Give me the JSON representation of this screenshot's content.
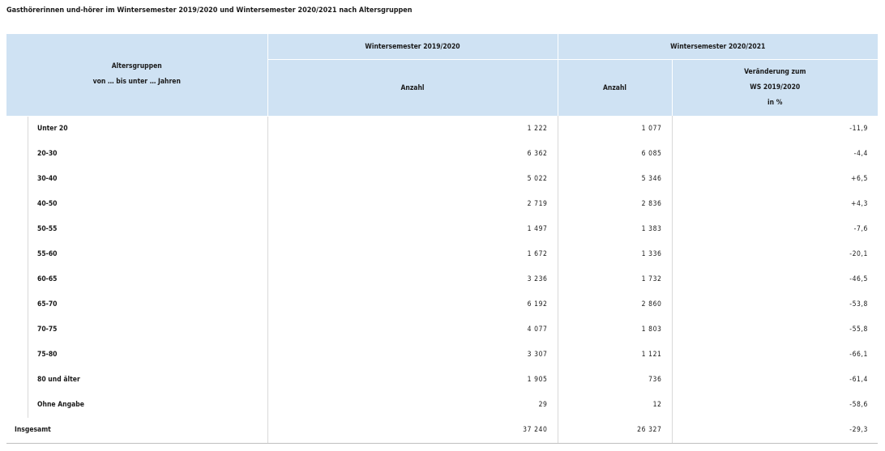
{
  "title": "Gasthörerinnen und-hörer im Wintersemester 2019/2020 und Wintersemester 2020/2021 nach Altersgruppen",
  "header": {
    "group_label_line1": "Altersgruppen",
    "group_label_line2": "von … bis unter … Jahren",
    "ws1": "Wintersemester 2019/2020",
    "ws2": "Wintersemester 2020/2021",
    "anzahl1": "Anzahl",
    "anzahl2": "Anzahl",
    "change_line1": "Veränderung zum",
    "change_line2": "WS 2019/2020",
    "change_line3": "in %"
  },
  "rows": [
    {
      "label": "Unter 20",
      "ws1": "1 222",
      "ws2": "1 077",
      "change": "-11,9"
    },
    {
      "label": "20-30",
      "ws1": "6 362",
      "ws2": "6 085",
      "change": "-4,4"
    },
    {
      "label": "30-40",
      "ws1": "5 022",
      "ws2": "5 346",
      "change": "+6,5"
    },
    {
      "label": "40-50",
      "ws1": "2 719",
      "ws2": "2 836",
      "change": "+4,3"
    },
    {
      "label": "50-55",
      "ws1": "1 497",
      "ws2": "1 383",
      "change": "-7,6"
    },
    {
      "label": "55-60",
      "ws1": "1 672",
      "ws2": "1 336",
      "change": "-20,1"
    },
    {
      "label": "60-65",
      "ws1": "3 236",
      "ws2": "1 732",
      "change": "-46,5"
    },
    {
      "label": "65-70",
      "ws1": "6 192",
      "ws2": "2 860",
      "change": "-53,8"
    },
    {
      "label": "70-75",
      "ws1": "4 077",
      "ws2": "1 803",
      "change": "-55,8"
    },
    {
      "label": "75-80",
      "ws1": "3 307",
      "ws2": "1 121",
      "change": "-66,1"
    },
    {
      "label": "80 und älter",
      "ws1": "1 905",
      "ws2": "736",
      "change": "-61,4"
    },
    {
      "label": "Ohne Angabe",
      "ws1": "29",
      "ws2": "12",
      "change": "-58,6"
    }
  ],
  "total": {
    "label": "Insgesamt",
    "ws1": "37 240",
    "ws2": "26 327",
    "change": "-29,3"
  }
}
